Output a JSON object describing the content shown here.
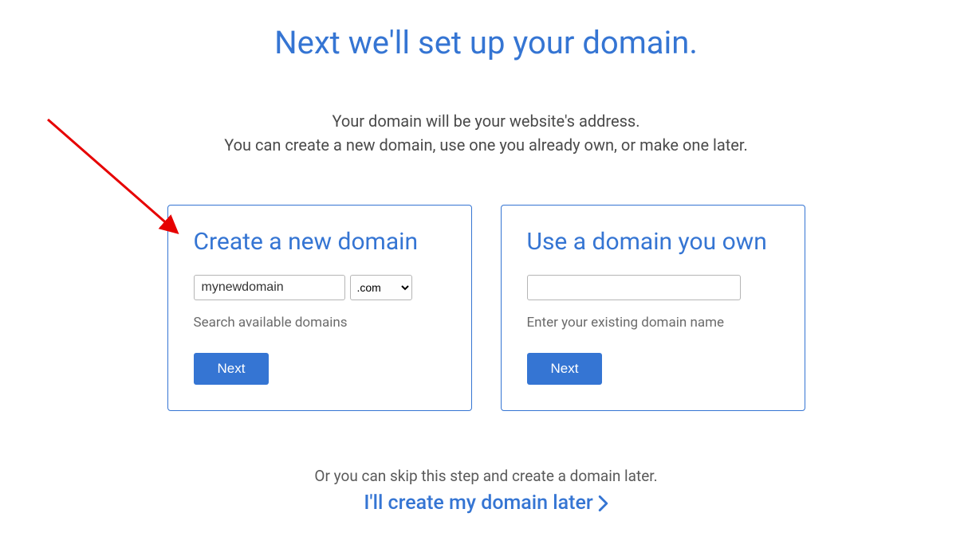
{
  "page_title": "Next we'll set up your domain.",
  "description_line1": "Your domain will be your website's address.",
  "description_line2": "You can create a new domain, use one you already own, or make one later.",
  "create_card": {
    "title": "Create a new domain",
    "input_value": "mynewdomain",
    "tld_selected": ".com",
    "helper": "Search available domains",
    "button": "Next"
  },
  "own_card": {
    "title": "Use a domain you own",
    "input_value": "",
    "helper": "Enter your existing domain name",
    "button": "Next"
  },
  "skip": {
    "text": "Or you can skip this step and create a domain later.",
    "link": "I'll create my domain later"
  },
  "colors": {
    "primary": "#3575d3",
    "text": "#4a4a4a",
    "helper": "#6b6b6b",
    "annotation": "#e60000"
  }
}
